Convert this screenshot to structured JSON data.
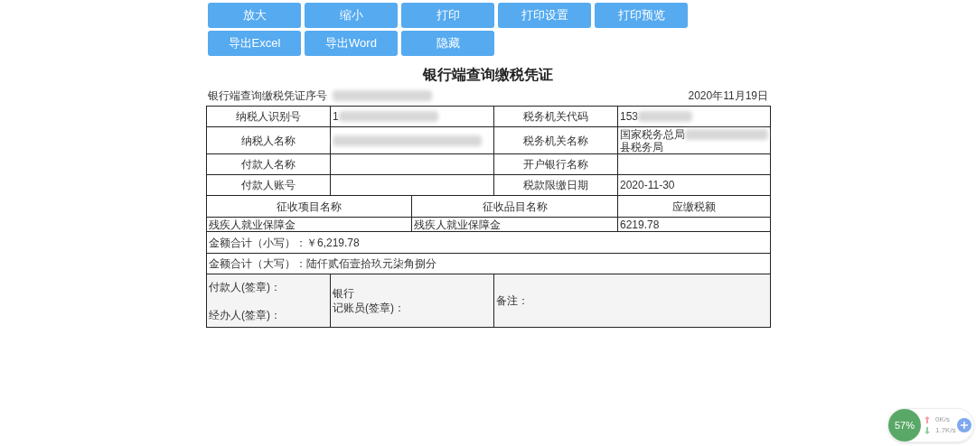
{
  "toolbar": {
    "buttons": [
      "放大",
      "缩小",
      "打印",
      "打印设置",
      "打印预览",
      "导出Excel",
      "导出Word",
      "隐藏"
    ]
  },
  "voucher": {
    "title": "银行端查询缴税凭证",
    "serial_label": "银行端查询缴税凭证序号",
    "date": "2020年11月19日",
    "info_rows": [
      {
        "label": "纳税人识别号",
        "value": "1",
        "value_redacted": true,
        "label_2": "税务机关代码",
        "value_2": "153",
        "value_2_redacted": true
      },
      {
        "label": "纳税人名称",
        "value": "",
        "value_redacted": true,
        "label_2": "税务机关名称",
        "value_2": "国家税务总局",
        "value_2_redacted": true,
        "value_2_line2": "县税务局"
      },
      {
        "label": "付款人名称",
        "value": "",
        "value_redacted": false,
        "label_2": "开户银行名称",
        "value_2": "",
        "value_2_redacted": false
      },
      {
        "label": "付款人账号",
        "value": "",
        "value_redacted": false,
        "label_2": "税款限缴日期",
        "value_2": "2020-11-30",
        "value_2_redacted": false
      }
    ],
    "item_columns": [
      "征收项目名称",
      "征收品目名称",
      "应缴税额"
    ],
    "item_rows": [
      [
        "残疾人就业保障金",
        "残疾人就业保障金",
        "6219.78"
      ]
    ],
    "total_small": "金额合计（小写）：￥6,219.78",
    "total_large": "金额合计（大写）：陆仟贰佰壹拾玖元柒角捌分",
    "signatures": {
      "payer": "付款人(签章)：",
      "handler": "经办人(签章)：",
      "bank": "银行",
      "bookkeeper": "记账员(签章)：",
      "remark": "备注："
    }
  },
  "speed_widget": {
    "percent": "57%",
    "upload": "0K/s",
    "download": "1.7K/s"
  }
}
